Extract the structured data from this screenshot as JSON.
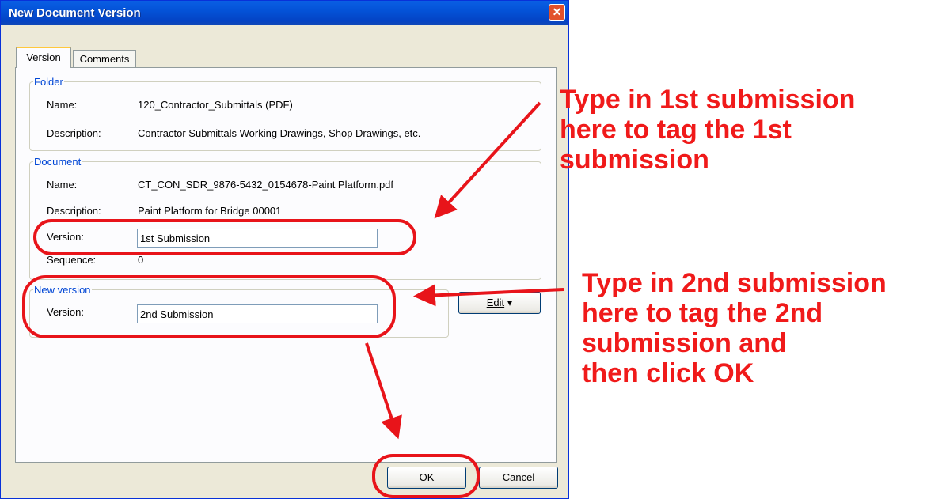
{
  "window": {
    "title": "New Document Version",
    "close_glyph": "✕",
    "tabs": [
      {
        "label": "Version",
        "active": true
      },
      {
        "label": "Comments",
        "active": false
      }
    ]
  },
  "folder": {
    "legend": "Folder",
    "name_label": "Name:",
    "name_value": "120_Contractor_Submittals (PDF)",
    "description_label": "Description:",
    "description_value": "Contractor Submittals Working Drawings, Shop Drawings, etc."
  },
  "document": {
    "legend": "Document",
    "name_label": "Name:",
    "name_value": "CT_CON_SDR_9876-5432_0154678-Paint Platform.pdf",
    "description_label": "Description:",
    "description_value": "Paint Platform for Bridge 00001",
    "version_label": "Version:",
    "version_value": "1st Submission",
    "sequence_label": "Sequence:",
    "sequence_value": "0"
  },
  "new_version": {
    "legend": "New version",
    "version_label": "Version:",
    "version_value": "2nd Submission",
    "edit_button": "Edit",
    "edit_glyph": "▾"
  },
  "buttons": {
    "ok": "OK",
    "cancel": "Cancel"
  },
  "annotations": {
    "note1": [
      "Type in 1st submission",
      "here to tag the 1st",
      "submission"
    ],
    "note2": [
      "Type in 2nd submission",
      "here to tag the 2nd",
      "submission and",
      "then click OK"
    ],
    "color": "#F01A1A"
  }
}
